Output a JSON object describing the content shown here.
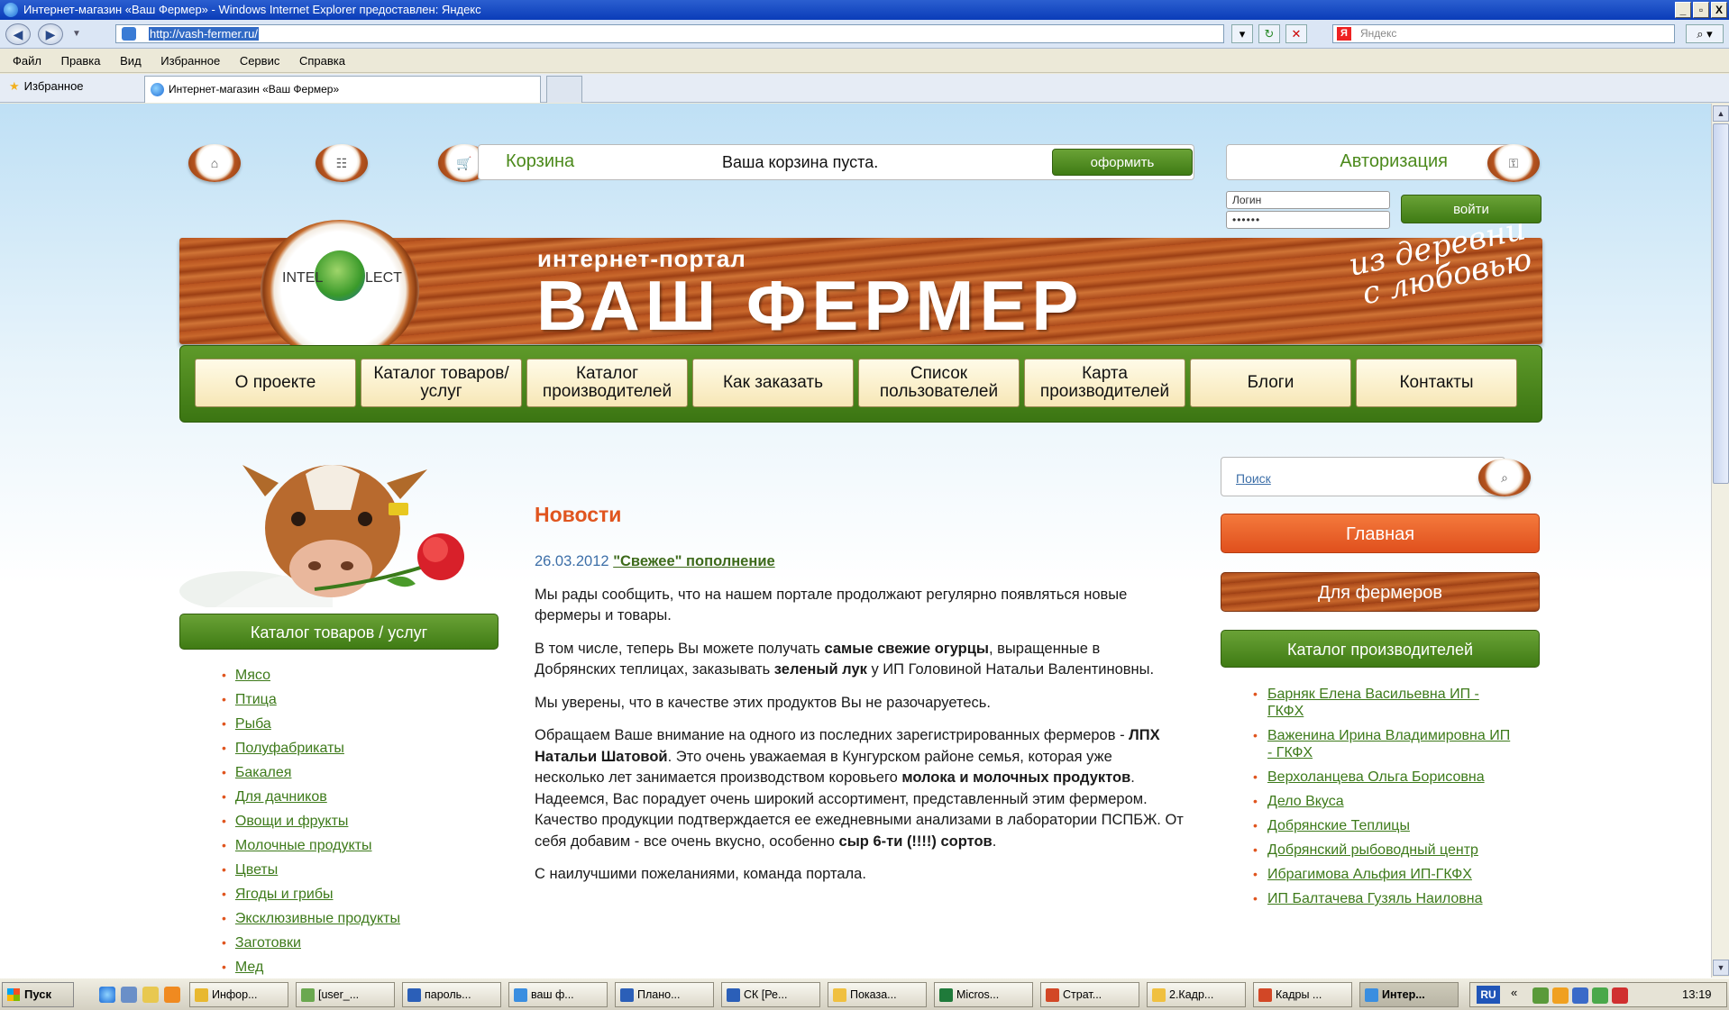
{
  "window": {
    "title": "Интернет-магазин «Ваш Фермер» - Windows Internet Explorer предоставлен: Яндекс",
    "controls": [
      "_",
      "▫",
      "X"
    ]
  },
  "addressbar": {
    "url": "http://vash-fermer.ru/",
    "search_placeholder": "Яндекс",
    "search_logo": "Я"
  },
  "menubar": {
    "items": [
      "Файл",
      "Правка",
      "Вид",
      "Избранное",
      "Сервис",
      "Справка"
    ]
  },
  "favbar": {
    "favorites_label": "Избранное",
    "tab_title": "Интернет-магазин «Ваш Фермер»"
  },
  "page": {
    "cart": {
      "title": "Корзина",
      "status": "Ваша корзина пуста.",
      "checkout_label": "оформить"
    },
    "auth": {
      "title": "Авторизация",
      "login_placeholder": "Логин",
      "password_value": "••••••",
      "login_button": "войти"
    },
    "banner": {
      "logo_left": "INTEL",
      "logo_right": "LECT",
      "subtitle": "интернет-портал",
      "title": "ВАШ ФЕРМЕР",
      "tagline_1": "из деревни",
      "tagline_2": "с любовью"
    },
    "nav": [
      {
        "label": "О проекте"
      },
      {
        "label": "Каталог товаров/услуг"
      },
      {
        "label": "Каталог производителей"
      },
      {
        "label": "Как заказать"
      },
      {
        "label": "Список пользователей"
      },
      {
        "label": "Карта производителей"
      },
      {
        "label": "Блоги"
      },
      {
        "label": "Контакты"
      }
    ],
    "catalog": {
      "header": "Каталог товаров / услуг",
      "items": [
        "Мясо",
        "Птица",
        "Рыба",
        "Полуфабрикаты",
        "Бакалея",
        "Для дачников",
        "Овощи и фрукты",
        "Молочные продукты",
        "Цветы",
        "Ягоды и грибы",
        "Эксклюзивные продукты",
        "Заготовки",
        "Мед"
      ]
    },
    "news": {
      "title": "Новости",
      "date": "26.03.2012",
      "headline": "\"Свежее\" пополнение",
      "p1": "Мы рады сообщить, что на нашем портале продолжают регулярно появляться новые фермеры и товары.",
      "p2_a": "В том числе, теперь Вы можете получать ",
      "p2_b": "самые свежие огурцы",
      "p2_c": ", выращенные в Добрянских теплицах, заказывать ",
      "p2_d": "зеленый лук",
      "p2_e": " у ИП Головиной Натальи Валентиновны.",
      "p3": "Мы уверены, что в качестве этих продуктов Вы не разочаруетесь.",
      "p4_a": "Обращаем Ваше внимание на одного из последних зарегистрированных фермеров - ",
      "p4_b": "ЛПХ Натальи Шатовой",
      "p4_c": ". Это очень уважаемая в Кунгурском районе семья, которая уже несколько лет занимается производством коровьего ",
      "p4_d": "молока и молочных продуктов",
      "p4_e": ". Надеемся, Вас порадует очень широкий ассортимент, представленный этим фермером. Качество продукции подтверждается ее ежедневными анализами в лаборатории ПСПБЖ. От себя добавим - все очень вкусно, особенно ",
      "p4_f": "сыр 6-ти (!!!!) сортов",
      "p4_g": ".",
      "p5": "С наилучшими пожеланиями, команда портала."
    },
    "sidebar": {
      "search_label": "Поиск",
      "main_button": "Главная",
      "farmers_button": "Для фермеров",
      "producers_header": "Каталог производителей",
      "producers": [
        "Барняк Елена Васильевна ИП - ГКФХ",
        "Важенина Ирина Владимировна ИП - ГКФХ",
        "Верхоланцева Ольга Борисовна",
        "Дело Вкуса",
        "Добрянские Теплицы",
        "Добрянский рыбоводный центр",
        "Ибрагимова Альфия ИП-ГКФХ",
        "ИП Балтачева Гузяль Наиловна"
      ]
    }
  },
  "taskbar": {
    "start_label": "Пуск",
    "tasks": [
      {
        "label": "Инфор...",
        "color": "#e8b830"
      },
      {
        "label": "[user_...",
        "color": "#6aa84f"
      },
      {
        "label": "пароль...",
        "color": "#2b5fb8"
      },
      {
        "label": "ваш ф...",
        "color": "#3a8ee0"
      },
      {
        "label": "Плано...",
        "color": "#2b5fb8"
      },
      {
        "label": "СК [Ре...",
        "color": "#2b5fb8"
      },
      {
        "label": "Показа...",
        "color": "#f0c040"
      },
      {
        "label": "Micros...",
        "color": "#1f7a3a"
      },
      {
        "label": "Страт...",
        "color": "#d24726"
      },
      {
        "label": "2.Кадр...",
        "color": "#f0c040"
      },
      {
        "label": "Кадры ...",
        "color": "#d24726"
      },
      {
        "label": "Интер...",
        "color": "#3a8ee0",
        "active": true
      }
    ],
    "language": "RU",
    "clock": "13:19"
  }
}
